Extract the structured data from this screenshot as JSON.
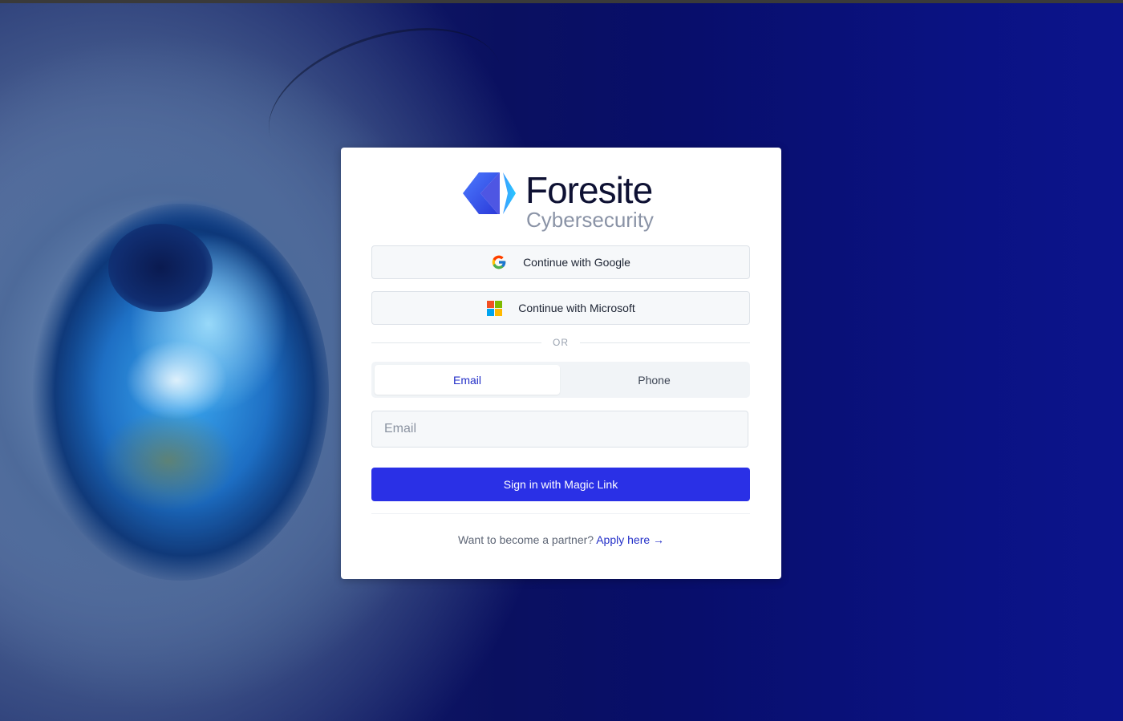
{
  "brand": {
    "name": "Foresite",
    "tagline": "Cybersecurity"
  },
  "social": {
    "google_label": "Continue with Google",
    "microsoft_label": "Continue with Microsoft"
  },
  "divider_label": "OR",
  "tabs": {
    "email": "Email",
    "phone": "Phone",
    "active": "email"
  },
  "email_input": {
    "placeholder": "Email",
    "value": ""
  },
  "primary_button_label": "Sign in with Magic Link",
  "partner": {
    "prompt": "Want to become a partner?",
    "link_label": "Apply here →"
  },
  "colors": {
    "primary": "#2a30e6",
    "tab_active_text": "#2430c8",
    "brand_dark": "#0e1133",
    "brand_sub": "#8a93a6",
    "background_blue": "#0a1282"
  },
  "icons": {
    "google": "google-icon",
    "microsoft": "microsoft-icon",
    "logo": "foresite-logo-mark"
  }
}
